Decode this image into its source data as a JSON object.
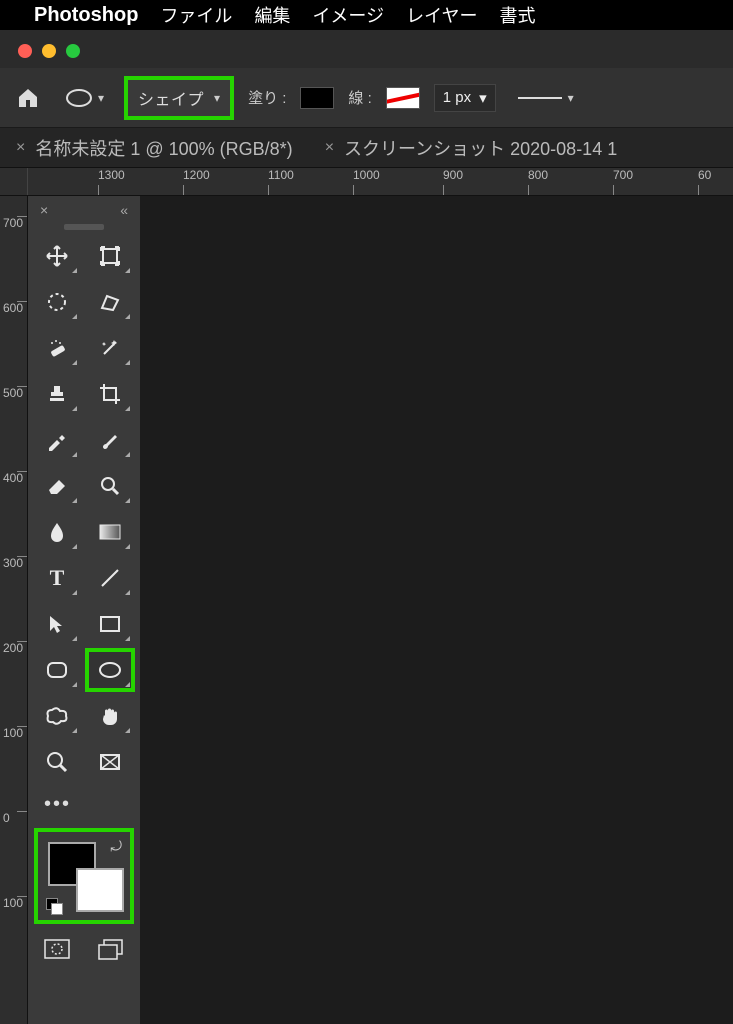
{
  "menubar": {
    "apple": "",
    "app_name": "Photoshop",
    "items": [
      "ファイル",
      "編集",
      "イメージ",
      "レイヤー",
      "書式"
    ]
  },
  "options_bar": {
    "shape_mode_label": "シェイプ",
    "fill_label": "塗り :",
    "stroke_label": "線 :",
    "stroke_width": "1 px"
  },
  "tabs": [
    {
      "title": "名称未設定 1 @ 100% (RGB/8*)"
    },
    {
      "title": "スクリーンショット 2020-08-14 1"
    }
  ],
  "ruler_top": [
    "1300",
    "1200",
    "1100",
    "1000",
    "900",
    "800",
    "700",
    "60"
  ],
  "ruler_left": [
    "700",
    "600",
    "500",
    "400",
    "300",
    "200",
    "100",
    "0",
    "100"
  ],
  "tools": {
    "row1": [
      "move-tool",
      "artboard-tool"
    ],
    "row2": [
      "marquee-tool",
      "lasso-poly-tool"
    ],
    "row3": [
      "heal-tool",
      "magic-wand-tool"
    ],
    "row4": [
      "stamp-tool",
      "crop-tool"
    ],
    "row5": [
      "eyedropper-tool",
      "brush-tool"
    ],
    "row6": [
      "eraser-tool",
      "zoom-lens-tool"
    ],
    "row7": [
      "drop-tool",
      "gradient-tool"
    ],
    "row8": [
      "type-tool",
      "line-tool"
    ],
    "row9": [
      "path-select-tool",
      "rectangle-shape-tool"
    ],
    "row10": [
      "rounded-rect-tool",
      "ellipse-shape-tool"
    ],
    "row11": [
      "custom-shape-tool",
      "hand-tool"
    ],
    "row12": [
      "zoom-tool",
      "frame-tool"
    ]
  },
  "type_glyph": "T",
  "more": "•••",
  "panel_collapse": "«",
  "panel_close": "×",
  "highlight_color": "#26d400"
}
